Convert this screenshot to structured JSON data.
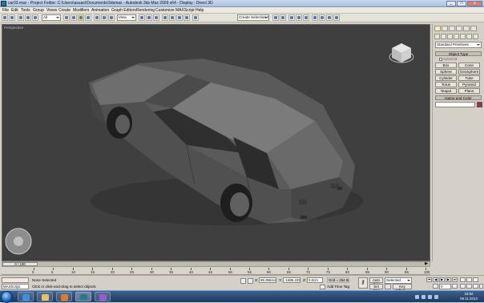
{
  "window": {
    "title": "car03.max - Project Folder: C:\\Users\\asuasi\\Documents\\3dsmax - Autodesk 3ds Max 2009 x64 - Display : Direct 3D",
    "controls": [
      "_",
      "□",
      "x"
    ]
  },
  "menu": [
    "File",
    "Edit",
    "Tools",
    "Group",
    "Views",
    "Create",
    "Modifiers",
    "Animation",
    "Graph Editors",
    "Rendering",
    "Customize",
    "MAXScript",
    "Help"
  ],
  "toolbar": {
    "selection_filter": "All",
    "reference_coord": "View",
    "named_selection": "Create Selection Set"
  },
  "viewport": {
    "label": "Perspective",
    "background": "#3f3f3f",
    "model": "car"
  },
  "command_panel": {
    "category": "Standard Primitives",
    "object_type_header": "Object Type",
    "autogrid_label": "AutoGrid",
    "primitives": [
      "Box",
      "Cone",
      "Sphere",
      "GeoSphere",
      "Cylinder",
      "Tube",
      "Torus",
      "Pyramid",
      "Teapot",
      "Plane"
    ],
    "name_color_header": "Name and Color",
    "object_color": "#a03040"
  },
  "timeline": {
    "slider_label": "0 / 100",
    "ticks": [
      "0",
      "5",
      "10",
      "15",
      "20",
      "25",
      "30",
      "35",
      "40",
      "45",
      "50",
      "55",
      "60",
      "65",
      "70",
      "75",
      "80",
      "85",
      "90",
      "95",
      "100"
    ]
  },
  "status": {
    "maxscript_label": "MAXScript.",
    "selection_status": "None Selected",
    "prompt": "Click or click-and-drag to select objects",
    "x_label": "X:",
    "x_value": "85.3564cm",
    "y_label": "Y:",
    "y_value": "-1695.2294",
    "z_label": "Z:",
    "z_value": "0.0cm",
    "grid": "Grid = 254.0mm",
    "add_time_tag": "Add Time Tag",
    "auto_key": "Auto Key",
    "set_key": "Set Key",
    "key_mode": "Selected",
    "key_filters": "Key Filters...",
    "frame": "0"
  },
  "taskbar": {
    "time": "18:52",
    "date": "09.11.2013"
  }
}
